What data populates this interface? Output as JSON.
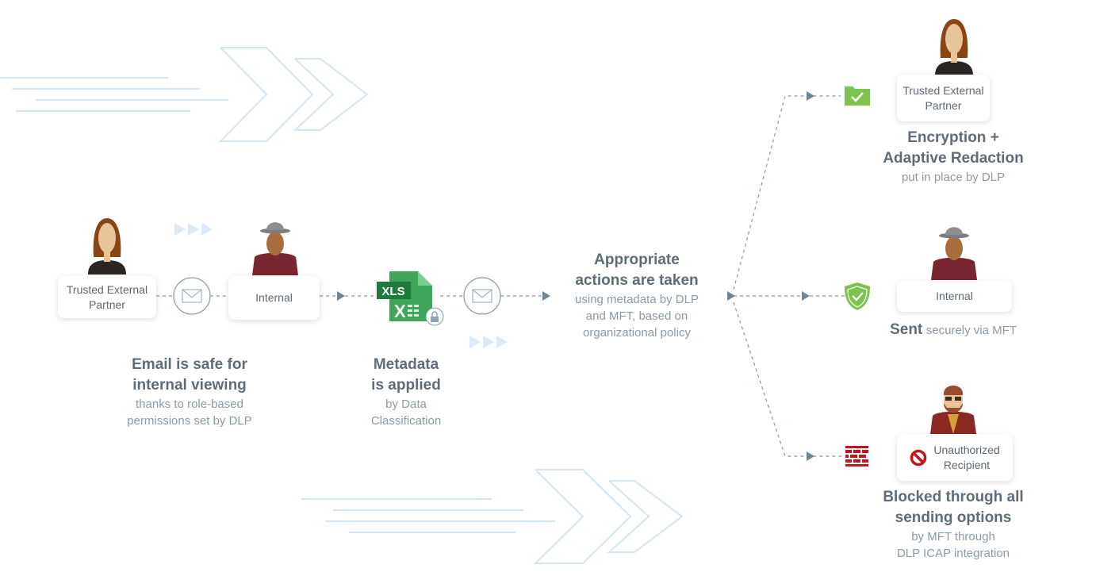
{
  "left": {
    "partner_card": {
      "line1": "Trusted External",
      "line2": "Partner"
    },
    "internal_card": "Internal",
    "caption": {
      "title1": "Email is safe for",
      "title2": "internal viewing",
      "sub1": "thanks to role-based",
      "sub2": "permissions set by DLP"
    }
  },
  "metadata": {
    "file_label": "XLS",
    "caption": {
      "title1": "Metadata",
      "title2": "is applied",
      "sub1": "by Data",
      "sub2": "Classification"
    }
  },
  "center": {
    "title1": "Appropriate",
    "title2": "actions are taken",
    "sub1": "using metadata by DLP",
    "sub2": "and MFT, based on",
    "sub3": "organizational policy"
  },
  "outcomes": {
    "trusted": {
      "card1": "Trusted External",
      "card2": "Partner",
      "title1": "Encryption +",
      "title2": "Adaptive Redaction",
      "sub": "put in place by DLP",
      "icon": "folder-check-icon"
    },
    "internal": {
      "card": "Internal",
      "title": "Sent",
      "sub": "securely via MFT",
      "icon": "shield-check-icon"
    },
    "blocked": {
      "card1": "Unauthorized",
      "card2": "Recipient",
      "title1": "Blocked through all",
      "title2": "sending options",
      "sub1": "by MFT through",
      "sub2": "DLP ICAP integration",
      "icon": "firewall-icon"
    }
  },
  "colors": {
    "green": "#7dc34e",
    "red": "#c0161c",
    "line": "#7a8c9a",
    "text": "#5f6c77",
    "subtext": "#8b9aa7"
  }
}
